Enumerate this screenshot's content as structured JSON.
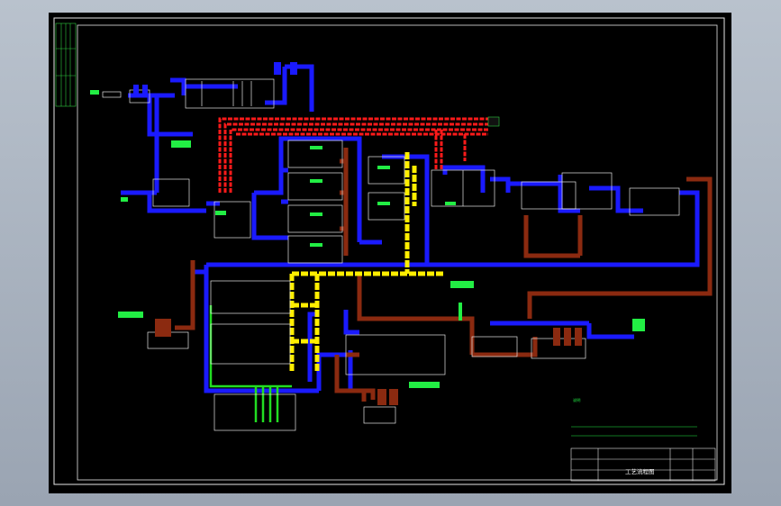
{
  "drawing": {
    "title_block": {
      "title": "工艺流程图",
      "fields": [
        "",
        "",
        "",
        "",
        "",
        ""
      ]
    },
    "notes_heading": "说明",
    "notes": [
      "",
      "",
      "",
      "",
      ""
    ],
    "legend": {
      "sewage_line_color": "#1a1aff",
      "sludge_line_color": "#8b2a10",
      "air_line_color": "#ff1a1a",
      "water_line_color": "#ffee00",
      "reuse_line_color": "#22dd22"
    }
  }
}
